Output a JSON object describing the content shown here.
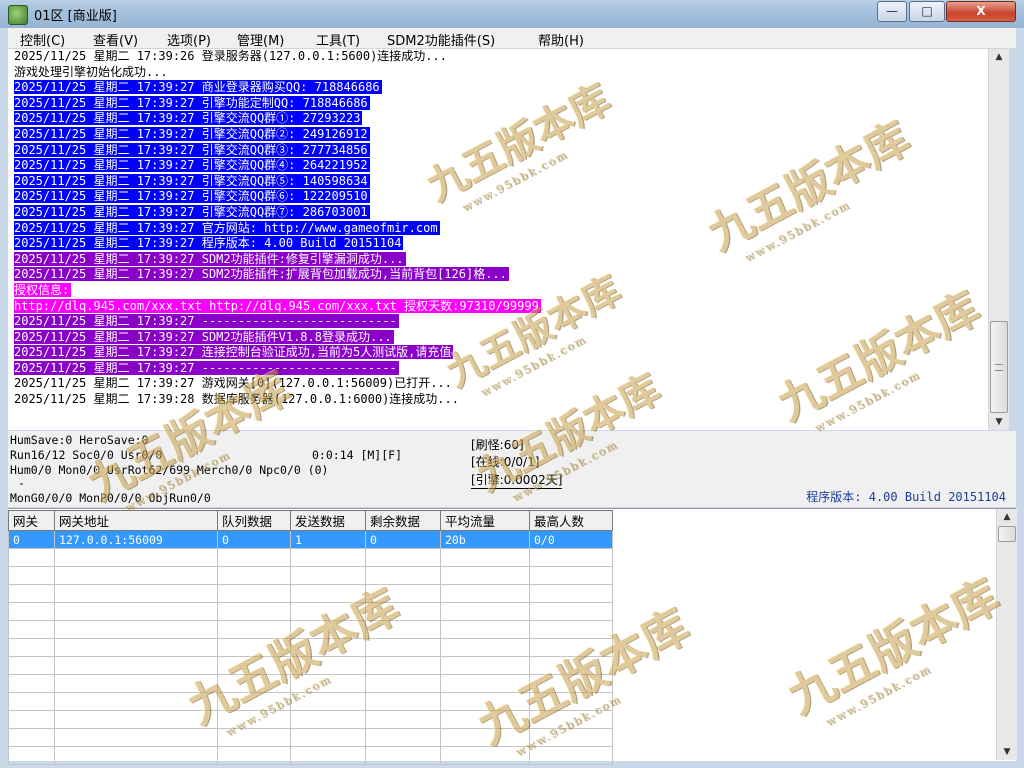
{
  "window": {
    "title": "01区 [商业版]",
    "buttons": {
      "minimize": "—",
      "maximize": "□",
      "close": "X"
    }
  },
  "menu": [
    {
      "label": "控制(C)"
    },
    {
      "label": "查看(V)"
    },
    {
      "label": "选项(P)"
    },
    {
      "label": "管理(M)"
    },
    {
      "label": "工具(T)"
    },
    {
      "label": "SDM2功能插件(S)"
    },
    {
      "label": "帮助(H)"
    }
  ],
  "log": [
    {
      "text": "2025/11/25 星期二 17:39:26 登录服务器(127.0.0.1:5600)连接成功...",
      "bg": "",
      "fg": "#000000"
    },
    {
      "text": "游戏处理引擎初始化成功...",
      "bg": "",
      "fg": "#000000"
    },
    {
      "text": "2025/11/25 星期二 17:39:27 商业登录器购买QQ: 718846686",
      "bg": "#0000ff",
      "fg": "#ffffff"
    },
    {
      "text": "2025/11/25 星期二 17:39:27 引擎功能定制QQ: 718846686",
      "bg": "#0000ff",
      "fg": "#ffffff"
    },
    {
      "text": "2025/11/25 星期二 17:39:27 引擎交流QQ群①: 27293223",
      "bg": "#0000ff",
      "fg": "#ffffff"
    },
    {
      "text": "2025/11/25 星期二 17:39:27 引擎交流QQ群②: 249126912",
      "bg": "#0000ff",
      "fg": "#ffffff"
    },
    {
      "text": "2025/11/25 星期二 17:39:27 引擎交流QQ群③: 277734856",
      "bg": "#0000ff",
      "fg": "#ffffff"
    },
    {
      "text": "2025/11/25 星期二 17:39:27 引擎交流QQ群④: 264221952",
      "bg": "#0000ff",
      "fg": "#ffffff"
    },
    {
      "text": "2025/11/25 星期二 17:39:27 引擎交流QQ群⑤: 140598634",
      "bg": "#0000ff",
      "fg": "#ffffff"
    },
    {
      "text": "2025/11/25 星期二 17:39:27 引擎交流QQ群⑥: 122209510",
      "bg": "#0000ff",
      "fg": "#ffffff"
    },
    {
      "text": "2025/11/25 星期二 17:39:27 引擎交流QQ群⑦: 286703001",
      "bg": "#0000ff",
      "fg": "#ffffff"
    },
    {
      "text": "2025/11/25 星期二 17:39:27 官方网站: http://www.gameofmir.com",
      "bg": "#0000ff",
      "fg": "#ffffff"
    },
    {
      "text": "2025/11/25 星期二 17:39:27 程序版本: 4.00 Build 20151104",
      "bg": "#0000ff",
      "fg": "#ffffff"
    },
    {
      "text": "2025/11/25 星期二 17:39:27 SDM2功能插件:修复引擎漏洞成功...",
      "bg": "#8a00c8",
      "fg": "#ffffff"
    },
    {
      "text": "2025/11/25 星期二 17:39:27 SDM2功能插件:扩展背包加载成功,当前背包[126]格...",
      "bg": "#8a00c8",
      "fg": "#ffffff"
    },
    {
      "text": "授权信息:",
      "bg": "#ff00ff",
      "fg": "#ffffff"
    },
    {
      "text": "http://dlq.945.com/xxx.txt http://dlq.945.com/xxx.txt 授权天数:97310/99999",
      "bg": "#ff00ff",
      "fg": "#ffffff"
    },
    {
      "text": "2025/11/25 星期二 17:39:27 ---------------------------",
      "bg": "#8a00c8",
      "fg": "#ffffff"
    },
    {
      "text": "2025/11/25 星期二 17:39:27 SDM2功能插件V1.8.8登录成功...",
      "bg": "#8a00c8",
      "fg": "#ffffff"
    },
    {
      "text": "2025/11/25 星期二 17:39:27 连接控制台验证成功,当前为5人测试版,请充值",
      "bg": "#8a00c8",
      "fg": "#ffffff"
    },
    {
      "text": "2025/11/25 星期二 17:39:27 ---------------------------",
      "bg": "#8a00c8",
      "fg": "#ffffff"
    },
    {
      "text": "2025/11/25 星期二 17:39:27 游戏网关[0](127.0.0.1:56009)已打开...",
      "bg": "",
      "fg": "#000000"
    },
    {
      "text": "2025/11/25 星期二 17:39:28 数据库服务器(127.0.0.1:6000)连接成功...",
      "bg": "",
      "fg": "#000000"
    }
  ],
  "status": {
    "line1": "HumSave:0 HeroSave:0",
    "line2": "Run16/12 Soc0/0 Usr0/0",
    "timer": "0:0:14 [M][F]",
    "line3": "Hum0/0 Mon0/0 UsrRot62/699 Merch0/0 Npc0/0 (0)",
    "line4": "-",
    "line5": "MonG0/0/0 MonP0/0/0 ObjRun0/0",
    "refresh": "[刷怪:60]",
    "online": "[在线:0/0/1]",
    "engine": "[引擎:0.0002天]",
    "version": "程序版本: 4.00 Build 20151104"
  },
  "grid": {
    "headers": [
      "网关",
      "网关地址",
      "队列数据",
      "发送数据",
      "剩余数据",
      "平均流量",
      "最高人数"
    ],
    "rows": [
      [
        "0",
        "127.0.0.1:56009",
        "0",
        "1",
        "0",
        "20b",
        "0/0"
      ]
    ]
  },
  "watermark": {
    "main": "九五版本库",
    "sub": "www.95bbk.com"
  }
}
